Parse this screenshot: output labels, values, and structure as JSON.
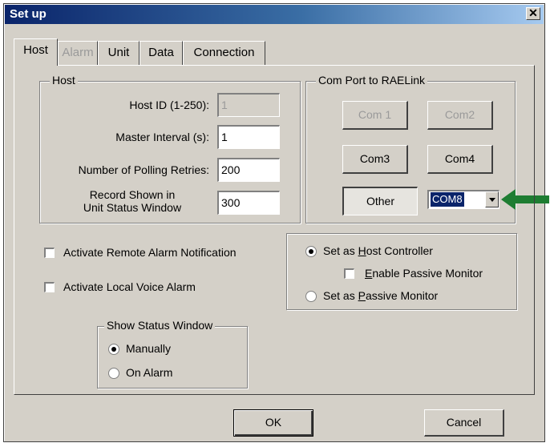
{
  "window": {
    "title": "Set up",
    "close_glyph": "✕"
  },
  "tabs": [
    {
      "label": "Host",
      "active": true,
      "enabled": true
    },
    {
      "label": "Alarm",
      "active": false,
      "enabled": false
    },
    {
      "label": "Unit",
      "active": false,
      "enabled": true
    },
    {
      "label": "Data",
      "active": false,
      "enabled": true
    },
    {
      "label": "Connection",
      "active": false,
      "enabled": true
    }
  ],
  "host_group": {
    "legend": "Host",
    "host_id_label": "Host ID (1-250):",
    "host_id_value": "1",
    "master_interval_label": "Master Interval (s):",
    "master_interval_value": "1",
    "polling_retries_label": "Number of Polling Retries:",
    "polling_retries_value": "200",
    "record_label_line1": "Record Shown in",
    "record_label_line2": "Unit Status Window",
    "record_value": "300"
  },
  "com_group": {
    "legend": "Com Port to RAELink",
    "com1": "Com 1",
    "com2": "Com2",
    "com3": "Com3",
    "com4": "Com4",
    "other": "Other",
    "selected_port": "COM8"
  },
  "checkboxes": {
    "remote_alarm": {
      "label": "Activate Remote Alarm Notification",
      "checked": false
    },
    "local_voice": {
      "label": "Activate Local Voice Alarm",
      "checked": false
    }
  },
  "controller_group": {
    "host_controller_prefix": "Set as ",
    "host_controller_u": "H",
    "host_controller_rest": "ost Controller",
    "host_controller_selected": true,
    "passive_check_u": "E",
    "passive_check_rest": "nable Passive Monitor",
    "passive_check_checked": false,
    "passive_monitor_prefix": "Set as ",
    "passive_monitor_u": "P",
    "passive_monitor_rest": "assive Monitor",
    "passive_monitor_selected": false
  },
  "status_window_group": {
    "legend": "Show Status Window",
    "manually": "Manually",
    "on_alarm": "On Alarm",
    "selected": "Manually"
  },
  "footer": {
    "ok": "OK",
    "cancel": "Cancel"
  },
  "colors": {
    "annotation_arrow": "#1e7d32",
    "title_bar": "#0a246a"
  }
}
